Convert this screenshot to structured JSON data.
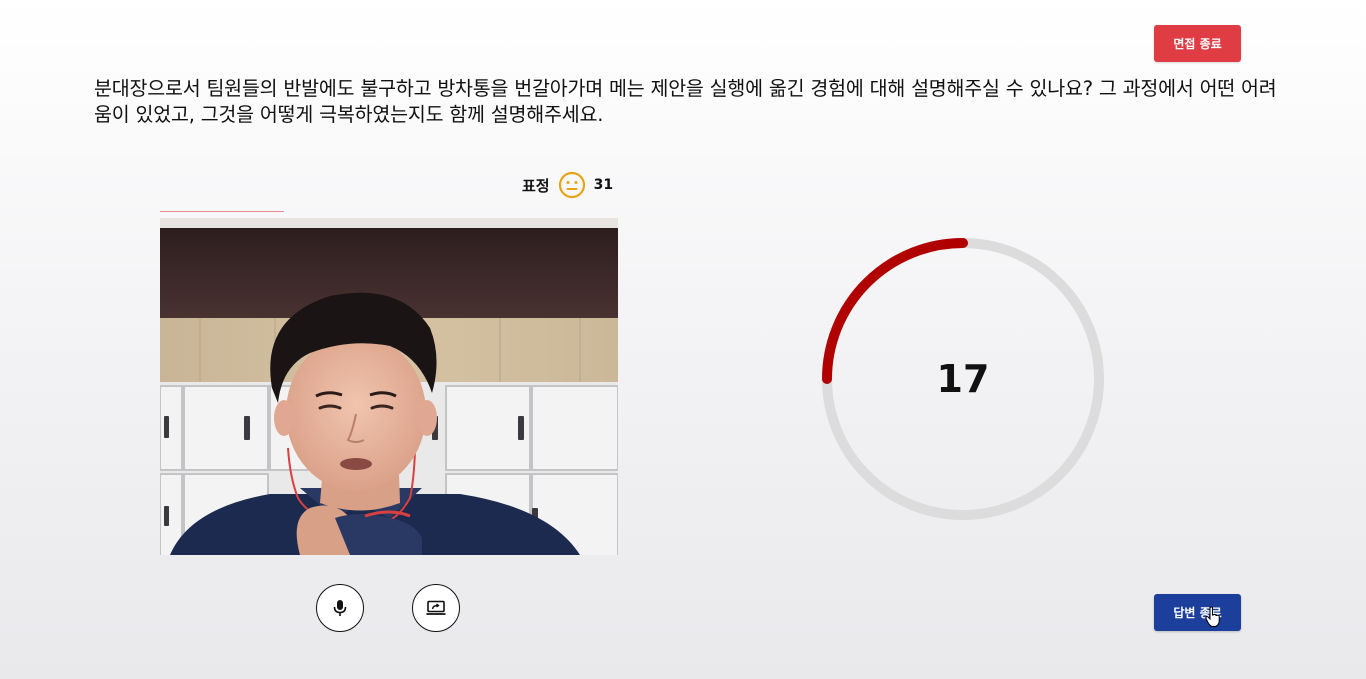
{
  "header": {
    "end_interview_label": "면접 종료"
  },
  "question": {
    "text": "분대장으로서 팀원들의 반발에도 불구하고 방차통을 번갈아가며 메는 제안을 실행에 옮긴 경험에 대해 설명해주실 수 있나요? 그 과정에서 어떤 어려움이 있었고, 그것을 어떻게 극복하였는지도 함께 설명해주세요."
  },
  "expression": {
    "label": "표정",
    "icon": "neutral-face-icon",
    "count": "31",
    "icon_color": "#e8a317"
  },
  "video": {
    "recording_progress": 0.27
  },
  "controls": {
    "mic_icon": "microphone-icon",
    "screen_icon": "screen-share-icon"
  },
  "timer": {
    "value": "17",
    "progress": 0.25,
    "arc_color": "#b00000",
    "track_color": "#dcdcdc"
  },
  "footer": {
    "answer_end_label": "답변 종료"
  },
  "colors": {
    "end_interview_bg": "#e03c44",
    "answer_end_bg": "#1d3f9c"
  }
}
